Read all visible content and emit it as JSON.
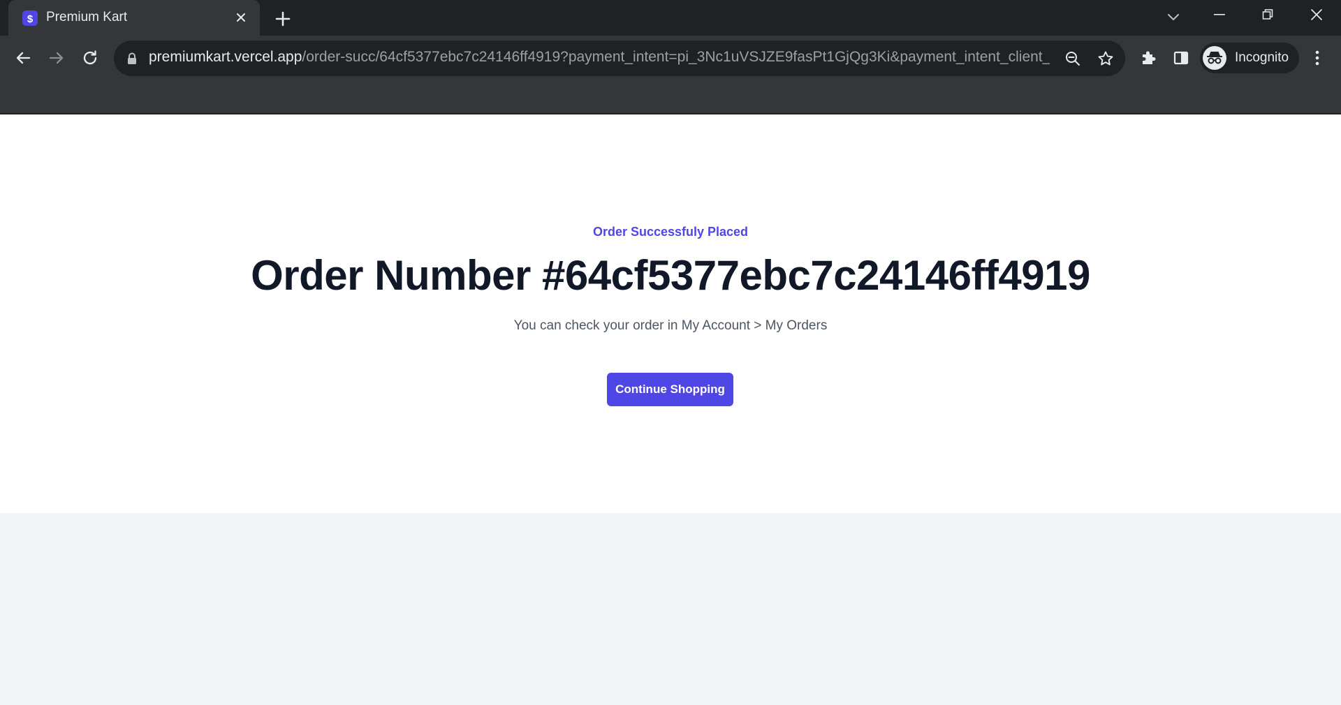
{
  "browser": {
    "tab": {
      "title": "Premium Kart"
    },
    "omnibox": {
      "host": "premiumkart.vercel.app",
      "path": "/order-succ/64cf5377ebc7c24146ff4919?payment_intent=pi_3Nc1uVSJZE9fasPt1GjQg3Ki&payment_intent_client_s..."
    },
    "profile": {
      "label": "Incognito"
    },
    "icons": {
      "favicon": "premium-kart-favicon",
      "tab_close": "close-icon",
      "new_tab": "plus-icon",
      "tab_search": "chevron-down-icon",
      "minimize": "minimize-icon",
      "restore": "restore-icon",
      "close_window": "close-icon",
      "back": "arrow-left-icon",
      "forward": "arrow-right-icon",
      "reload": "reload-icon",
      "lock": "lock-icon",
      "zoom": "zoom-out-icon",
      "bookmark": "star-icon",
      "extensions": "puzzle-icon",
      "side_panel": "side-panel-icon",
      "incognito": "incognito-icon",
      "menu": "kebab-menu-icon"
    }
  },
  "order_success": {
    "eyebrow": "Order Successfuly Placed",
    "headline": "Order Number #64cf5377ebc7c24146ff4919",
    "subtext": "You can check your order in My Account > My Orders",
    "cta_label": "Continue Shopping"
  },
  "colors": {
    "accent": "#4f46e5",
    "heading": "#111827",
    "body_text": "#4b5563",
    "page_bg": "#f3f4f6",
    "card_bg": "#ffffff",
    "chrome_dark": "#202124",
    "chrome_toolbar": "#35363a"
  }
}
